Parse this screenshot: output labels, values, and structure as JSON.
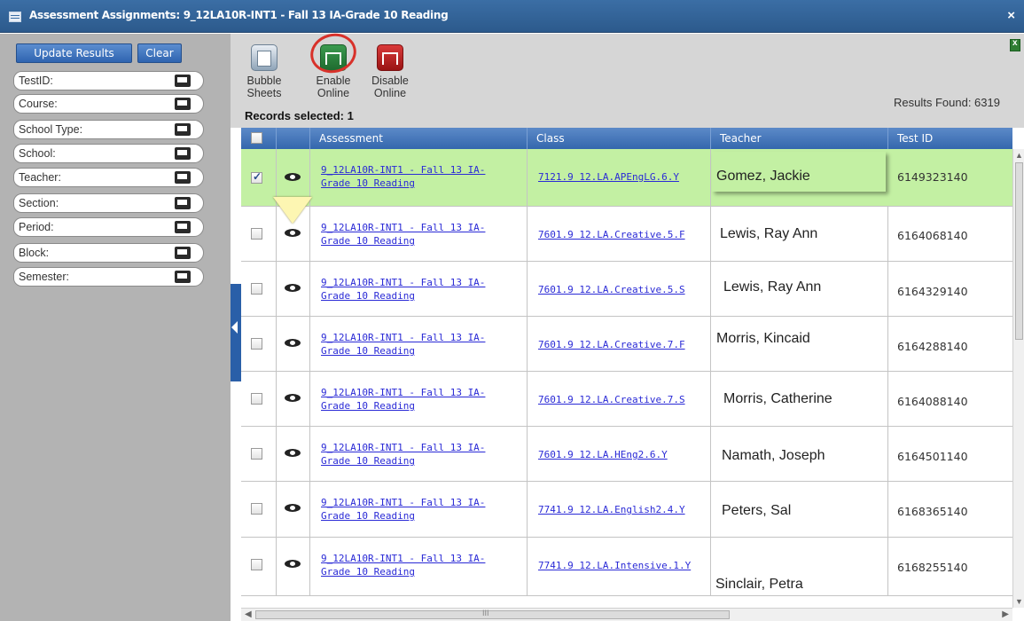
{
  "window": {
    "title": "Assessment Assignments: 9_12LA10R-INT1 - Fall 13 IA-Grade 10 Reading",
    "close_label": "×"
  },
  "sidebar": {
    "update_label": "Update Results",
    "clear_label": "Clear",
    "filters": [
      "TestID:",
      "Course:",
      "School Type:",
      "School:",
      "Teacher:",
      "Section:",
      "Period:",
      "Block:",
      "Semester:"
    ]
  },
  "toolbar": {
    "bubble_line1": "Bubble",
    "bubble_line2": "Sheets",
    "enable_line1": "Enable",
    "enable_line2": "Online",
    "disable_line1": "Disable",
    "disable_line2": "Online",
    "records_selected": "Records selected: 1",
    "results_found": "Results Found: 6319"
  },
  "grid": {
    "columns": [
      "Assessment",
      "Class",
      "Teacher",
      "Test ID"
    ],
    "rows": [
      {
        "selected": true,
        "assessment_line1": "9_12LA10R-INT1 - Fall 13 IA-",
        "assessment_line2": "Grade 10 Reading",
        "class": "7121.9 12.LA.APEngLG.6.Y",
        "teacher": "Gomez, Jackie",
        "test_id": "6149323140"
      },
      {
        "selected": false,
        "assessment_line1": "9_12LA10R-INT1 - Fall 13 IA-",
        "assessment_line2": "Grade 10 Reading",
        "class": "7601.9 12.LA.Creative.5.F",
        "teacher": "Lewis, Ray Ann",
        "test_id": "6164068140"
      },
      {
        "selected": false,
        "assessment_line1": "9_12LA10R-INT1 - Fall 13 IA-",
        "assessment_line2": "Grade 10 Reading",
        "class": "7601.9 12.LA.Creative.5.S",
        "teacher": "Lewis, Ray Ann",
        "test_id": "6164329140"
      },
      {
        "selected": false,
        "assessment_line1": "9_12LA10R-INT1 - Fall 13 IA-",
        "assessment_line2": "Grade 10 Reading",
        "class": "7601.9 12.LA.Creative.7.F",
        "teacher": "Morris, Kincaid",
        "test_id": "6164288140"
      },
      {
        "selected": false,
        "assessment_line1": "9_12LA10R-INT1 - Fall 13 IA-",
        "assessment_line2": "Grade 10 Reading",
        "class": "7601.9 12.LA.Creative.7.S",
        "teacher": "Morris, Catherine",
        "test_id": "6164088140"
      },
      {
        "selected": false,
        "assessment_line1": "9_12LA10R-INT1 - Fall 13 IA-",
        "assessment_line2": "Grade 10 Reading",
        "class": "7601.9 12.LA.HEng2.6.Y",
        "teacher": "Namath, Joseph",
        "test_id": "6164501140"
      },
      {
        "selected": false,
        "assessment_line1": "9_12LA10R-INT1 - Fall 13 IA-",
        "assessment_line2": "Grade 10 Reading",
        "class": "7741.9 12.LA.English2.4.Y",
        "teacher": "Peters, Sal",
        "test_id": "6168365140"
      },
      {
        "selected": false,
        "assessment_line1": "9_12LA10R-INT1 - Fall 13 IA-",
        "assessment_line2": "Grade 10 Reading",
        "class": "7741.9 12.LA.Intensive.1.Y",
        "teacher": "Sinclair, Petra",
        "test_id": "6168255140"
      }
    ]
  },
  "scrollbar": {
    "grip": "III"
  }
}
